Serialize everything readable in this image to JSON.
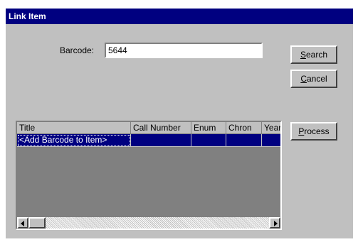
{
  "window": {
    "title": "Link Item"
  },
  "barcode": {
    "label": "Barcode:",
    "value": "5644"
  },
  "buttons": {
    "search": {
      "mnemonic": "S",
      "rest": "earch"
    },
    "cancel": {
      "mnemonic": "C",
      "rest": "ancel"
    },
    "process": {
      "mnemonic": "P",
      "rest": "rocess"
    }
  },
  "grid": {
    "columns": [
      "Title",
      "Call Number",
      "Enum",
      "Chron",
      "Year"
    ],
    "rows": [
      {
        "cells": [
          "<Add Barcode to Item>",
          "",
          "",
          "",
          ""
        ]
      }
    ]
  },
  "scrollbar": {
    "left_icon": "arrow-left-icon",
    "right_icon": "arrow-right-icon"
  }
}
